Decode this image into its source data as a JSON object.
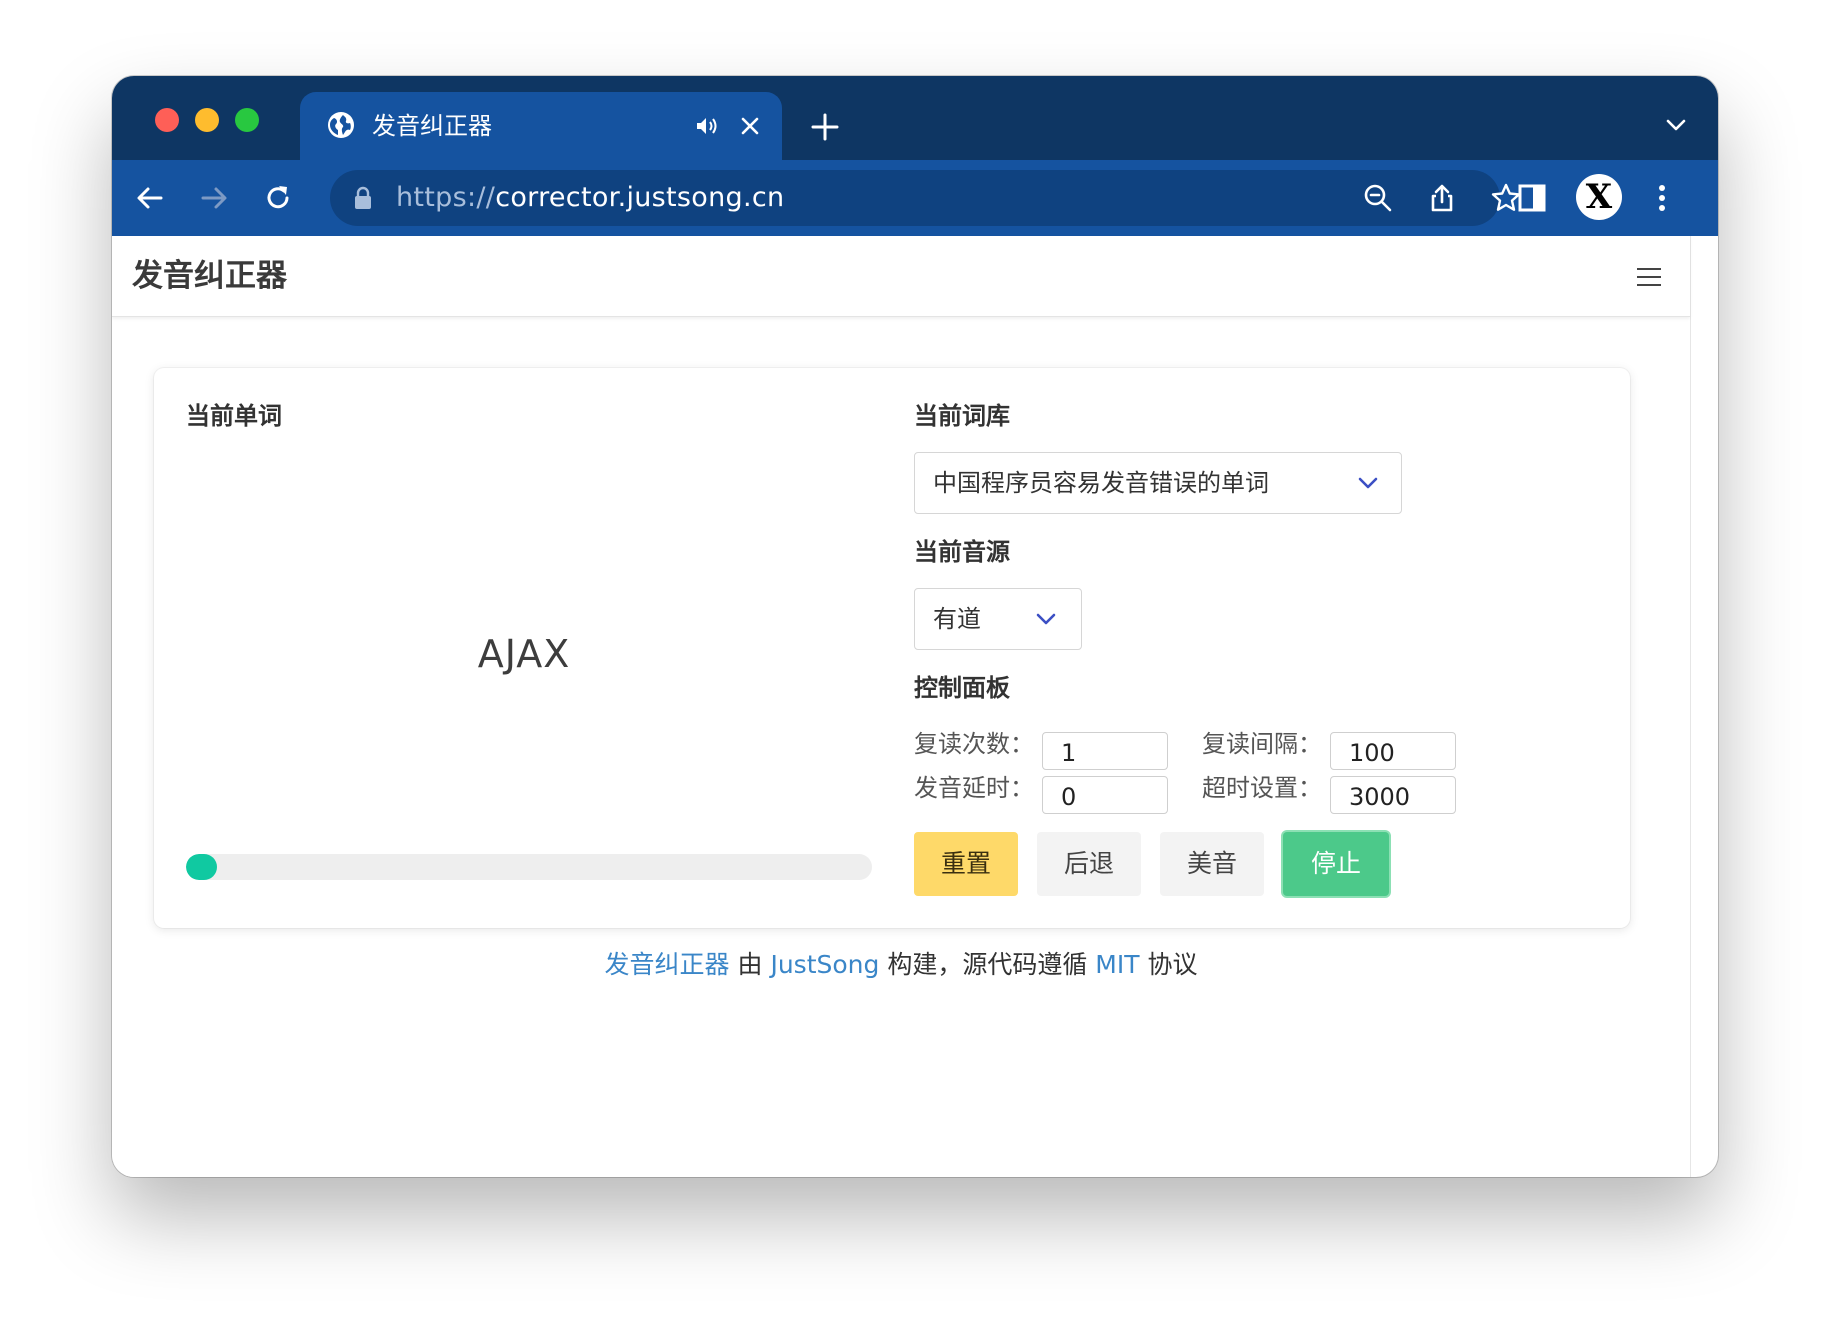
{
  "browser": {
    "tab_title": "发音纠正器",
    "url_scheme": "https://",
    "url_host": "corrector.justsong.cn",
    "avatar_letter": "X",
    "colors": {
      "tabstrip": "#0e3663",
      "toolbar": "#1553a0",
      "omnibox": "#0f4280"
    }
  },
  "navbar": {
    "brand": "发音纠正器"
  },
  "card": {
    "current_word_label": "当前单词",
    "current_word": "AJAX",
    "progress_fraction": 0.045,
    "wordbank_label": "当前词库",
    "wordbank_selected": "中国程序员容易发音错误的单词",
    "source_label": "当前音源",
    "source_selected": "有道",
    "panel_label": "控制面板",
    "repeat_count_label": "复读次数：",
    "repeat_count": "1",
    "repeat_interval_label": "复读间隔：",
    "repeat_interval": "100",
    "delay_label": "发音延时：",
    "delay": "0",
    "timeout_label": "超时设置：",
    "timeout": "3000",
    "buttons": {
      "reset": "重置",
      "back": "后退",
      "us": "美音",
      "stop": "停止"
    },
    "colors": {
      "reset": "#fed969",
      "back": "#f3f3f3",
      "us": "#f3f3f3",
      "stop": "#4cc98a",
      "progress": "#10c9a1"
    }
  },
  "footer": {
    "app_link": "发音纠正器",
    "by": " 由 ",
    "author_link": "JustSong",
    "middle": " 构建，源代码遵循 ",
    "license_link": "MIT",
    "end": " 协议"
  }
}
